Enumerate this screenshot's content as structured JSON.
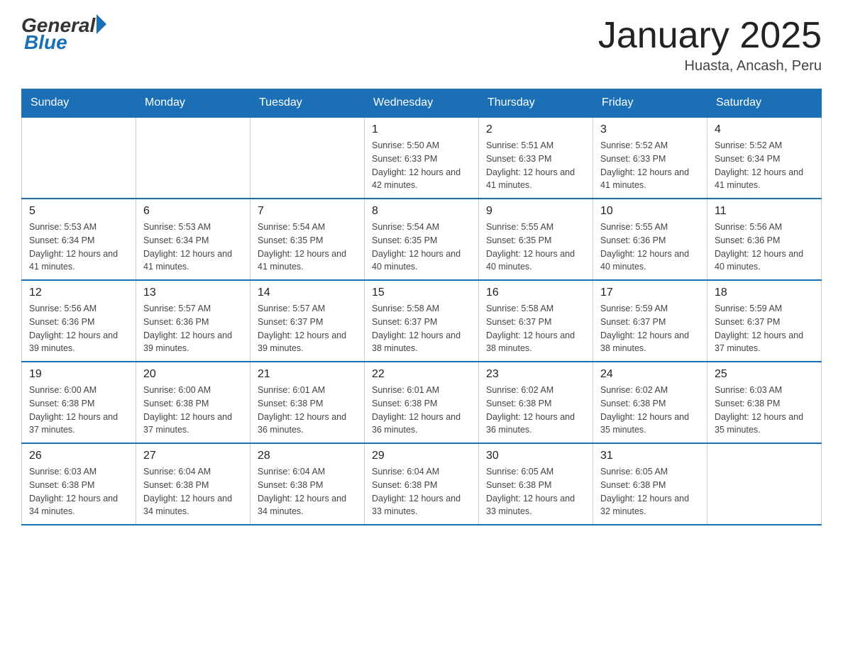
{
  "logo": {
    "general": "General",
    "blue": "Blue"
  },
  "title": "January 2025",
  "location": "Huasta, Ancash, Peru",
  "days_of_week": [
    "Sunday",
    "Monday",
    "Tuesday",
    "Wednesday",
    "Thursday",
    "Friday",
    "Saturday"
  ],
  "weeks": [
    [
      {
        "day": "",
        "sunrise": "",
        "sunset": "",
        "daylight": ""
      },
      {
        "day": "",
        "sunrise": "",
        "sunset": "",
        "daylight": ""
      },
      {
        "day": "",
        "sunrise": "",
        "sunset": "",
        "daylight": ""
      },
      {
        "day": "1",
        "sunrise": "Sunrise: 5:50 AM",
        "sunset": "Sunset: 6:33 PM",
        "daylight": "Daylight: 12 hours and 42 minutes."
      },
      {
        "day": "2",
        "sunrise": "Sunrise: 5:51 AM",
        "sunset": "Sunset: 6:33 PM",
        "daylight": "Daylight: 12 hours and 41 minutes."
      },
      {
        "day": "3",
        "sunrise": "Sunrise: 5:52 AM",
        "sunset": "Sunset: 6:33 PM",
        "daylight": "Daylight: 12 hours and 41 minutes."
      },
      {
        "day": "4",
        "sunrise": "Sunrise: 5:52 AM",
        "sunset": "Sunset: 6:34 PM",
        "daylight": "Daylight: 12 hours and 41 minutes."
      }
    ],
    [
      {
        "day": "5",
        "sunrise": "Sunrise: 5:53 AM",
        "sunset": "Sunset: 6:34 PM",
        "daylight": "Daylight: 12 hours and 41 minutes."
      },
      {
        "day": "6",
        "sunrise": "Sunrise: 5:53 AM",
        "sunset": "Sunset: 6:34 PM",
        "daylight": "Daylight: 12 hours and 41 minutes."
      },
      {
        "day": "7",
        "sunrise": "Sunrise: 5:54 AM",
        "sunset": "Sunset: 6:35 PM",
        "daylight": "Daylight: 12 hours and 41 minutes."
      },
      {
        "day": "8",
        "sunrise": "Sunrise: 5:54 AM",
        "sunset": "Sunset: 6:35 PM",
        "daylight": "Daylight: 12 hours and 40 minutes."
      },
      {
        "day": "9",
        "sunrise": "Sunrise: 5:55 AM",
        "sunset": "Sunset: 6:35 PM",
        "daylight": "Daylight: 12 hours and 40 minutes."
      },
      {
        "day": "10",
        "sunrise": "Sunrise: 5:55 AM",
        "sunset": "Sunset: 6:36 PM",
        "daylight": "Daylight: 12 hours and 40 minutes."
      },
      {
        "day": "11",
        "sunrise": "Sunrise: 5:56 AM",
        "sunset": "Sunset: 6:36 PM",
        "daylight": "Daylight: 12 hours and 40 minutes."
      }
    ],
    [
      {
        "day": "12",
        "sunrise": "Sunrise: 5:56 AM",
        "sunset": "Sunset: 6:36 PM",
        "daylight": "Daylight: 12 hours and 39 minutes."
      },
      {
        "day": "13",
        "sunrise": "Sunrise: 5:57 AM",
        "sunset": "Sunset: 6:36 PM",
        "daylight": "Daylight: 12 hours and 39 minutes."
      },
      {
        "day": "14",
        "sunrise": "Sunrise: 5:57 AM",
        "sunset": "Sunset: 6:37 PM",
        "daylight": "Daylight: 12 hours and 39 minutes."
      },
      {
        "day": "15",
        "sunrise": "Sunrise: 5:58 AM",
        "sunset": "Sunset: 6:37 PM",
        "daylight": "Daylight: 12 hours and 38 minutes."
      },
      {
        "day": "16",
        "sunrise": "Sunrise: 5:58 AM",
        "sunset": "Sunset: 6:37 PM",
        "daylight": "Daylight: 12 hours and 38 minutes."
      },
      {
        "day": "17",
        "sunrise": "Sunrise: 5:59 AM",
        "sunset": "Sunset: 6:37 PM",
        "daylight": "Daylight: 12 hours and 38 minutes."
      },
      {
        "day": "18",
        "sunrise": "Sunrise: 5:59 AM",
        "sunset": "Sunset: 6:37 PM",
        "daylight": "Daylight: 12 hours and 37 minutes."
      }
    ],
    [
      {
        "day": "19",
        "sunrise": "Sunrise: 6:00 AM",
        "sunset": "Sunset: 6:38 PM",
        "daylight": "Daylight: 12 hours and 37 minutes."
      },
      {
        "day": "20",
        "sunrise": "Sunrise: 6:00 AM",
        "sunset": "Sunset: 6:38 PM",
        "daylight": "Daylight: 12 hours and 37 minutes."
      },
      {
        "day": "21",
        "sunrise": "Sunrise: 6:01 AM",
        "sunset": "Sunset: 6:38 PM",
        "daylight": "Daylight: 12 hours and 36 minutes."
      },
      {
        "day": "22",
        "sunrise": "Sunrise: 6:01 AM",
        "sunset": "Sunset: 6:38 PM",
        "daylight": "Daylight: 12 hours and 36 minutes."
      },
      {
        "day": "23",
        "sunrise": "Sunrise: 6:02 AM",
        "sunset": "Sunset: 6:38 PM",
        "daylight": "Daylight: 12 hours and 36 minutes."
      },
      {
        "day": "24",
        "sunrise": "Sunrise: 6:02 AM",
        "sunset": "Sunset: 6:38 PM",
        "daylight": "Daylight: 12 hours and 35 minutes."
      },
      {
        "day": "25",
        "sunrise": "Sunrise: 6:03 AM",
        "sunset": "Sunset: 6:38 PM",
        "daylight": "Daylight: 12 hours and 35 minutes."
      }
    ],
    [
      {
        "day": "26",
        "sunrise": "Sunrise: 6:03 AM",
        "sunset": "Sunset: 6:38 PM",
        "daylight": "Daylight: 12 hours and 34 minutes."
      },
      {
        "day": "27",
        "sunrise": "Sunrise: 6:04 AM",
        "sunset": "Sunset: 6:38 PM",
        "daylight": "Daylight: 12 hours and 34 minutes."
      },
      {
        "day": "28",
        "sunrise": "Sunrise: 6:04 AM",
        "sunset": "Sunset: 6:38 PM",
        "daylight": "Daylight: 12 hours and 34 minutes."
      },
      {
        "day": "29",
        "sunrise": "Sunrise: 6:04 AM",
        "sunset": "Sunset: 6:38 PM",
        "daylight": "Daylight: 12 hours and 33 minutes."
      },
      {
        "day": "30",
        "sunrise": "Sunrise: 6:05 AM",
        "sunset": "Sunset: 6:38 PM",
        "daylight": "Daylight: 12 hours and 33 minutes."
      },
      {
        "day": "31",
        "sunrise": "Sunrise: 6:05 AM",
        "sunset": "Sunset: 6:38 PM",
        "daylight": "Daylight: 12 hours and 32 minutes."
      },
      {
        "day": "",
        "sunrise": "",
        "sunset": "",
        "daylight": ""
      }
    ]
  ]
}
